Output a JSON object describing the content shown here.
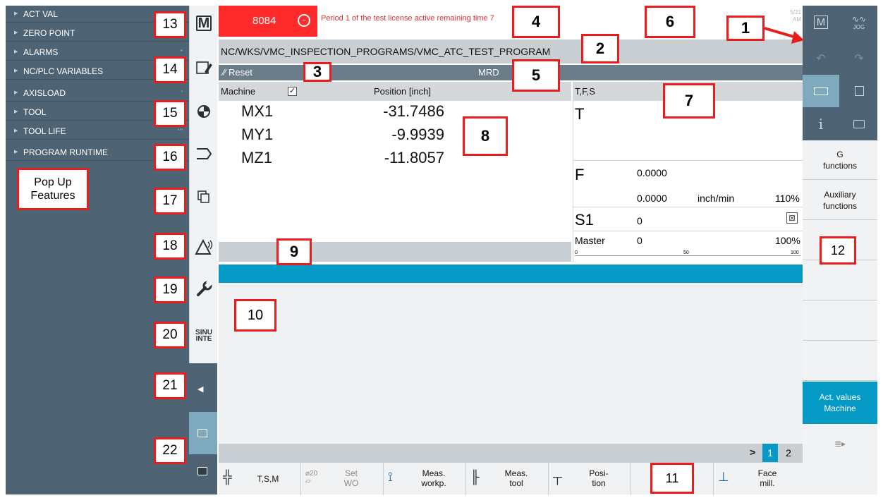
{
  "alarm": {
    "number": "8084",
    "message": "Period 1 of the test license active remaining time 7"
  },
  "header": {
    "timestamp_partial": "5/21\nAM"
  },
  "path": "NC/WKS/VMC_INSPECTION_PROGRAMS/VMC_ATC_TEST_PROGRAM",
  "status": {
    "reset": "⁄⁄ Reset",
    "mrd": "MRD"
  },
  "position": {
    "header_label": "Machine",
    "header_title": "Position [inch]",
    "axes": [
      {
        "name": "MX1",
        "value": "-31.7486"
      },
      {
        "name": "MY1",
        "value": "-9.9939"
      },
      {
        "name": "MZ1",
        "value": "-11.8057"
      }
    ]
  },
  "tfs": {
    "title": "T,F,S",
    "t_label": "T",
    "f_label": "F",
    "f_value1": "0.0000",
    "f_value2": "0.0000",
    "f_unit": "inch/min",
    "f_override": "110%",
    "s_label": "S1",
    "s_value": "0",
    "master_label": "Master",
    "master_value": "0",
    "master_override": "100%",
    "scale": [
      "0",
      "50",
      "100"
    ]
  },
  "popup": {
    "items": [
      {
        "label": "ACT VAL",
        "mark": ""
      },
      {
        "label": "ZERO POINT",
        "mark": "\""
      },
      {
        "label": "ALARMS",
        "mark": "\""
      },
      {
        "label": "NC/PLC VARIABLES",
        "mark": "\""
      },
      {
        "label": "AXISLOAD",
        "mark": "'"
      },
      {
        "label": "TOOL",
        "mark": "'"
      },
      {
        "label": "TOOL LIFE",
        "mark": "'''"
      },
      {
        "label": "PROGRAM RUNTIME",
        "mark": ""
      }
    ]
  },
  "page_nav": {
    "arrow": ">",
    "page1": "1",
    "page2": "2"
  },
  "horizontal_softkeys": [
    {
      "label": "T,S,M"
    },
    {
      "label": "Set\nWO",
      "sub": "20"
    },
    {
      "label": "Meas.\nworkp."
    },
    {
      "label": "Meas.\ntool"
    },
    {
      "label": "Posi-\ntion"
    },
    {
      "label": ""
    },
    {
      "label": "Face\nmill."
    }
  ],
  "vertical_softkeys": [
    {
      "label": "G\nfunctions"
    },
    {
      "label": "Auxiliary\nfunctions"
    },
    {
      "label": ""
    },
    {
      "label": ""
    },
    {
      "label": ""
    },
    {
      "label": ""
    },
    {
      "label": "Act. values\nMachine"
    }
  ],
  "right_top": {
    "m_label": "M",
    "jog_label": "JOG"
  },
  "callouts": {
    "c1": "1",
    "c2": "2",
    "c3": "3",
    "c4": "4",
    "c5": "5",
    "c6": "6",
    "c7": "7",
    "c8": "8",
    "c9": "9",
    "c10": "10",
    "c11": "11",
    "c12": "12",
    "c13": "13",
    "c14": "14",
    "c15": "15",
    "c16": "16",
    "c17": "17",
    "c18": "18",
    "c19": "19",
    "c20": "20",
    "c21": "21",
    "c22": "22",
    "popup_label": "Pop Up\nFeatures"
  },
  "colors": {
    "accent": "#0599c6",
    "alarm": "#ff2a2a",
    "panel": "#4e6474",
    "callout": "#ea1c1c"
  },
  "icons": {
    "strip": [
      "machine-icon",
      "program-edit-icon",
      "offset-icon",
      "program-icon",
      "program-manager-icon",
      "diagnostics-icon",
      "setup-icon",
      "sinumerik-icon"
    ]
  }
}
